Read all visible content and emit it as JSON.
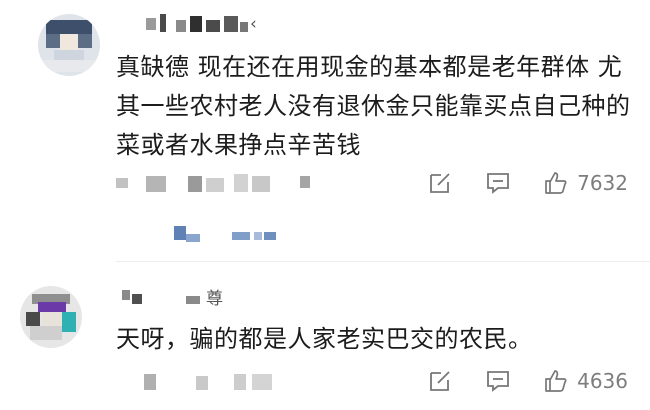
{
  "comments": [
    {
      "username_visible": "‹",
      "text": "真缺德 现在还在用现金的基本都是老年群体 尤其一些农村老人没有退休金只能靠买点自己种的菜或者水果挣点辛苦钱",
      "likes": "7632"
    },
    {
      "username_visible": "尊",
      "text": "天呀，骗的都是人家老实巴交的农民。",
      "likes": "4636"
    }
  ],
  "icons": [
    "share-icon",
    "comment-icon",
    "like-icon"
  ]
}
